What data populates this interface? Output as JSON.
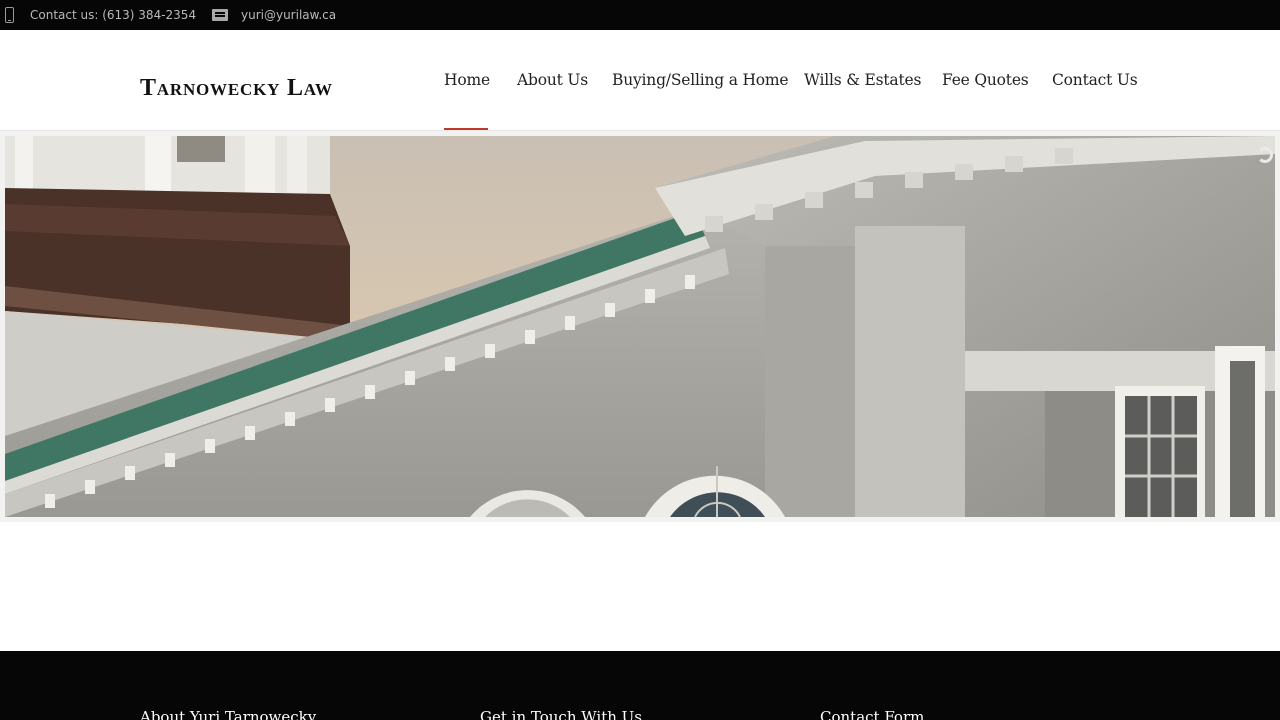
{
  "topbar": {
    "phone_icon": "mobile-phone-icon",
    "phone_text": "Contact us: (613) 384-2354",
    "email_icon": "envelope-icon",
    "email_text": "yuri@yurilaw.ca"
  },
  "header": {
    "logo": "Tarnowecky Law"
  },
  "nav": {
    "home": "Home",
    "about": "About Us",
    "buying": "Buying/Selling a Home",
    "wills": "Wills & Estates",
    "fees": "Fee Quotes",
    "contact": "Contact Us",
    "active": "home",
    "active_color": "#c0392b"
  },
  "hero": {
    "image": "building-facade-photo",
    "loader_icon": "loading-spinner-icon"
  },
  "footer": {
    "about_heading": "About Yuri Tarnowecky",
    "touch_heading": "Get in Touch With Us",
    "form_heading": "Contact Form"
  }
}
